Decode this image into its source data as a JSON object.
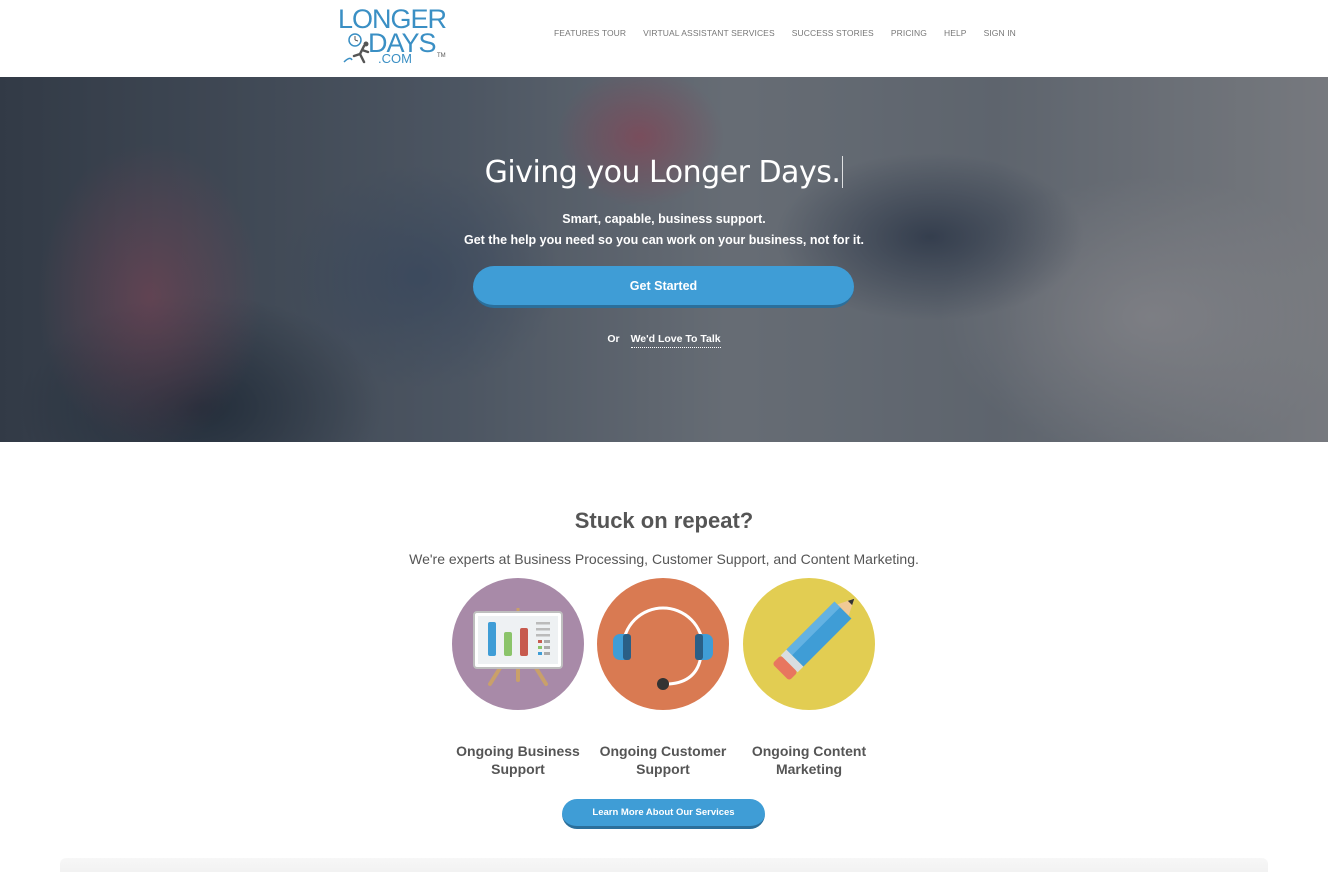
{
  "logo": {
    "line1": "LONGER",
    "line2": "DAYS",
    "line3": ".COM",
    "tm": "TM"
  },
  "nav": {
    "items": [
      {
        "label": "FEATURES TOUR"
      },
      {
        "label": "VIRTUAL ASSISTANT SERVICES"
      },
      {
        "label": "SUCCESS STORIES"
      },
      {
        "label": "PRICING"
      },
      {
        "label": "HELP"
      },
      {
        "label": "SIGN IN"
      }
    ]
  },
  "hero": {
    "title": "Giving you Longer Days.",
    "subtitle_line1": "Smart, capable, business support.",
    "subtitle_line2": "Get the help you need so you can work on your business, not for it.",
    "cta_label": "Get Started",
    "or_text": "Or",
    "talk_link": "We'd Love To Talk"
  },
  "services": {
    "title": "Stuck on repeat?",
    "subtitle": "We're experts at Business Processing, Customer Support, and Content Marketing.",
    "items": [
      {
        "label": "Ongoing Business Support",
        "icon": "presentation-board-icon",
        "color": "#a88aa8"
      },
      {
        "label": "Ongoing Customer Support",
        "icon": "headset-icon",
        "color": "#d97a52"
      },
      {
        "label": "Ongoing Content Marketing",
        "icon": "pencil-icon",
        "color": "#e2cd52"
      }
    ],
    "learn_more_label": "Learn More About Our Services"
  },
  "colors": {
    "accent": "#3f9dd6",
    "brand": "#3a8fc4"
  }
}
